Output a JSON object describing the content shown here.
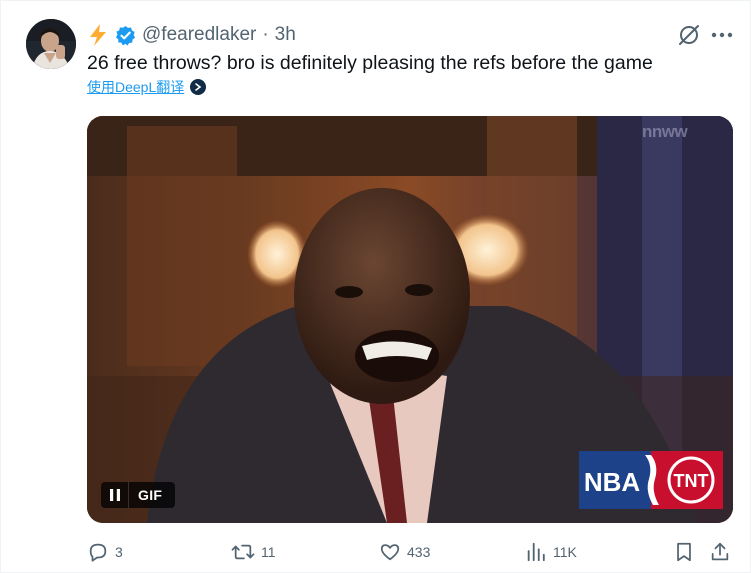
{
  "tweet": {
    "author_emoji": "bolt-emoji",
    "handle": "@fearedlaker",
    "separator": "·",
    "time": "3h",
    "text": "26 free throws? bro is definitely pleasing the refs before the game",
    "translate_label": "使用DeepL翻译",
    "verified_color": "#1d9bf0"
  },
  "media": {
    "badge_label": "GIF",
    "watermark": "nnww",
    "network_logo_left": "NBA",
    "network_logo_right": "TNT"
  },
  "actions": {
    "reply_count": "3",
    "retweet_count": "11",
    "like_count": "433",
    "view_count": "11K"
  },
  "colors": {
    "accent": "#1d9bf0",
    "muted": "#536471",
    "text": "#0f1419"
  }
}
